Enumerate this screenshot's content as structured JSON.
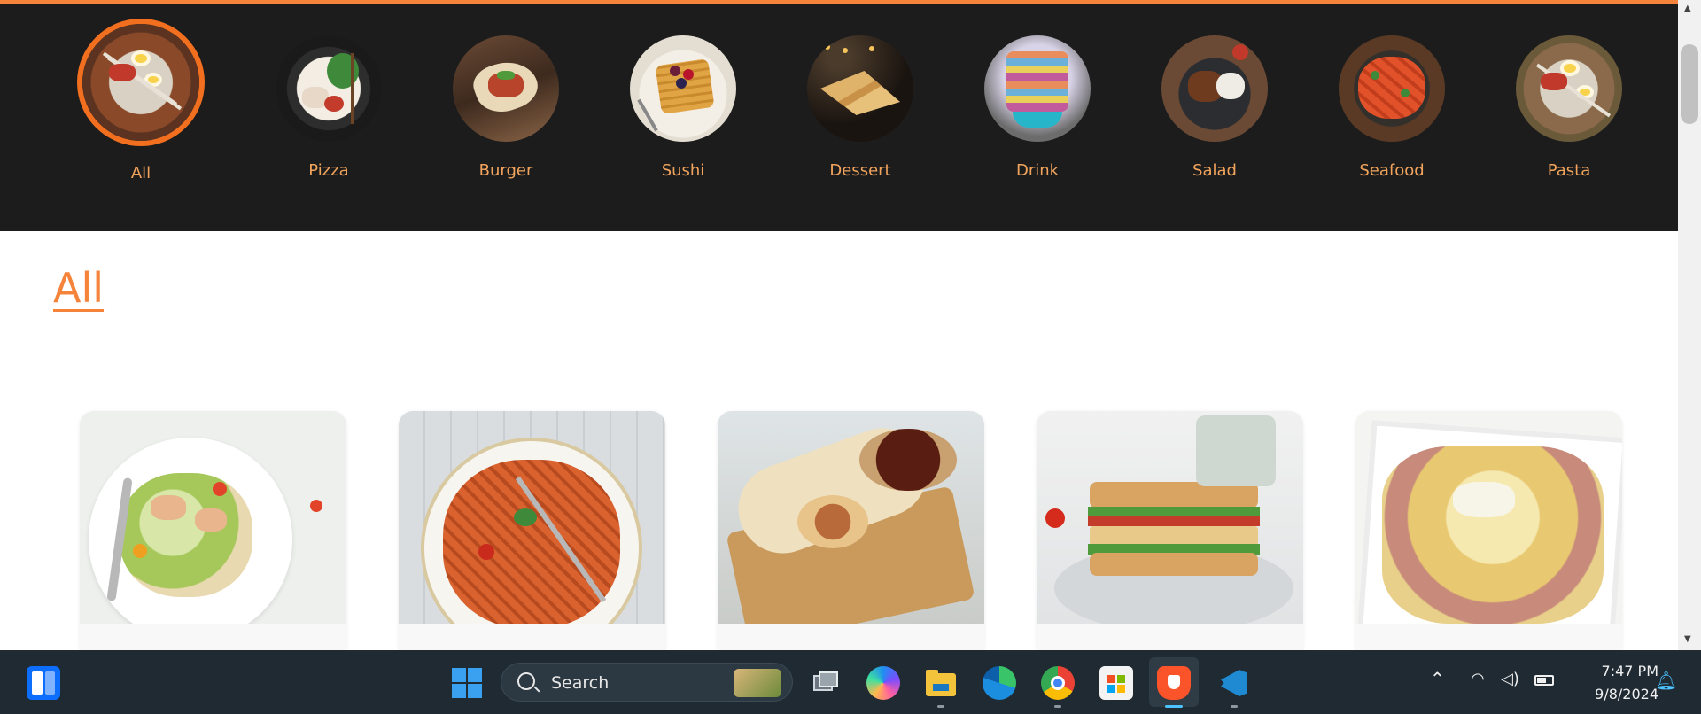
{
  "categories": [
    {
      "label": "All",
      "active": true
    },
    {
      "label": "Pizza"
    },
    {
      "label": "Burger"
    },
    {
      "label": "Sushi"
    },
    {
      "label": "Dessert"
    },
    {
      "label": "Drink"
    },
    {
      "label": "Salad"
    },
    {
      "label": "Seafood"
    },
    {
      "label": "Pasta"
    }
  ],
  "section": {
    "title": "All"
  },
  "cards": [
    {
      "image": "caesar-salad-image"
    },
    {
      "image": "fusilli-pasta-image"
    },
    {
      "image": "burrito-wrap-image"
    },
    {
      "image": "club-sandwich-image"
    },
    {
      "image": "pasta-ham-cheese-image"
    }
  ],
  "taskbar": {
    "search_label": "Search",
    "time": "7:47 PM",
    "date": "9/8/2024"
  },
  "colors": {
    "accent": "#f5843a",
    "category_label": "#f2a45d",
    "header_bg": "#1c1c1c",
    "taskbar_bg": "#1f2a33"
  }
}
